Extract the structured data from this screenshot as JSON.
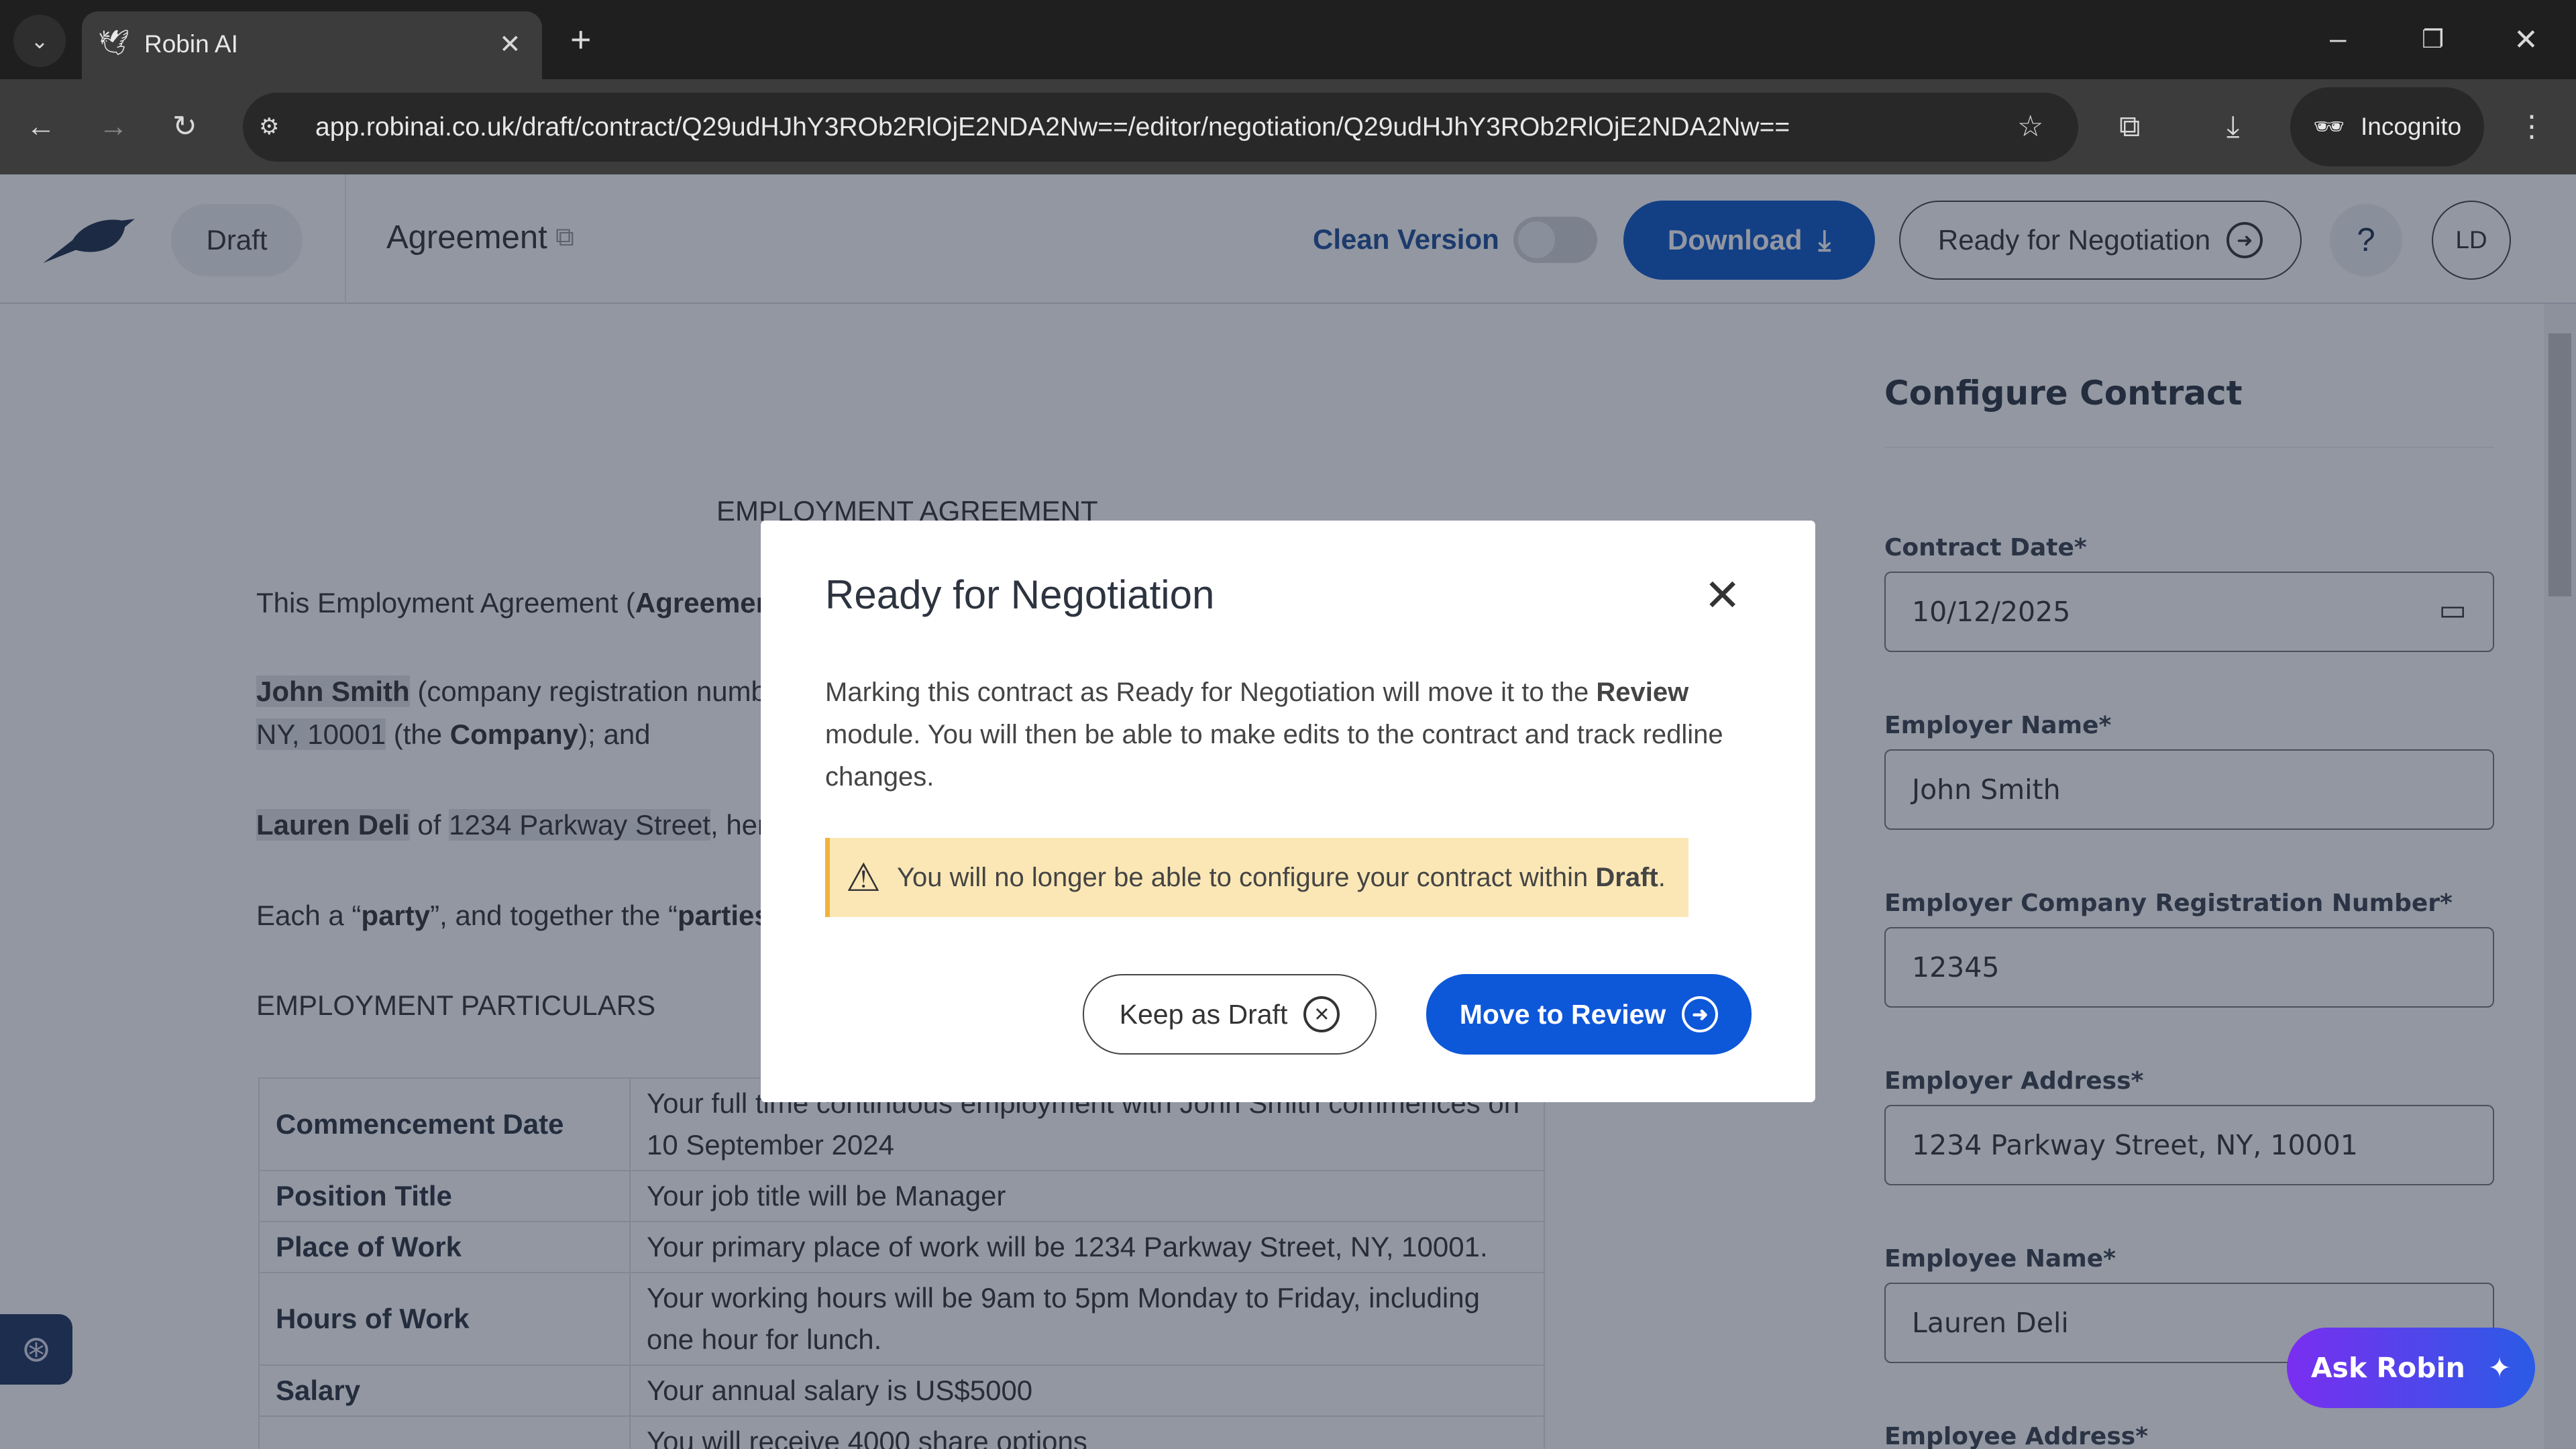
{
  "browser": {
    "tab_title": "Robin AI",
    "url": "app.robinai.co.uk/draft/contract/Q29udHJhY3ROb2RlOjE2NDA2Nw==/editor/negotiation/Q29udHJhY3ROb2RlOjE2NDA2Nw==",
    "incognito_label": "Incognito"
  },
  "header": {
    "status": "Draft",
    "title": "Agreement",
    "clean_version": "Clean Version",
    "clean_version_on": false,
    "download": "Download",
    "ready": "Ready for Negotiation",
    "avatar": "LD",
    "accent": "#0d57c9"
  },
  "document": {
    "heading": "EMPLOYMENT AGREEMENT",
    "p1": {
      "a": "This Employment Agreement (",
      "b": "Agreemen"
    },
    "p2": {
      "name": "John Smith",
      "rest": " (company registration numbe",
      "l2a": "NY, 10001",
      "l2b": " (the ",
      "l2c": "Company",
      "l2d": "); and"
    },
    "p3": {
      "name": "Lauren Deli",
      "of": " of ",
      "addr": "1234 Parkway Street",
      "rest": ", here"
    },
    "p4": {
      "a": "Each a “",
      "b": "party",
      "c": "”, and together the “",
      "d": "parties",
      "e": "”."
    },
    "section": "EMPLOYMENT PARTICULARS",
    "rows": [
      {
        "k": "Commencement Date",
        "v": "Your full time continuous employment with John Smith commences on 10 September 2024"
      },
      {
        "k": "Position Title",
        "v": "Your job title will be Manager"
      },
      {
        "k": "Place of Work",
        "v": "Your primary place of work will be 1234 Parkway Street, NY, 10001."
      },
      {
        "k": "Hours of Work",
        "v": "Your working hours will be 9am to 5pm Monday to Friday, including one hour for lunch."
      },
      {
        "k": "Salary",
        "v": "Your annual salary is US$5000"
      },
      {
        "k": "",
        "v": "You will receive 4000 share options"
      }
    ]
  },
  "panel": {
    "title": "Configure Contract",
    "fields": [
      {
        "label": "Contract Date*",
        "value": "10/12/2025"
      },
      {
        "label": "Employer Name*",
        "value": "John Smith"
      },
      {
        "label": "Employer Company Registration Number*",
        "value": "12345"
      },
      {
        "label": "Employer Address*",
        "value": "1234 Parkway Street, NY, 10001"
      },
      {
        "label": "Employee Name*",
        "value": "Lauren Deli"
      },
      {
        "label": "Employee Address*",
        "value": ""
      }
    ],
    "ask_robin": "Ask Robin"
  },
  "modal": {
    "title": "Ready for Negotiation",
    "body_a": "Marking this contract as Ready for Negotiation will move it to the ",
    "body_b": "Review",
    "body_c": " module. You will then be able to make edits to the contract and track redline changes.",
    "warning_a": "You will no longer be able to configure your contract within ",
    "warning_b": "Draft",
    "warning_c": ".",
    "keep": "Keep as Draft",
    "move": "Move to Review"
  }
}
